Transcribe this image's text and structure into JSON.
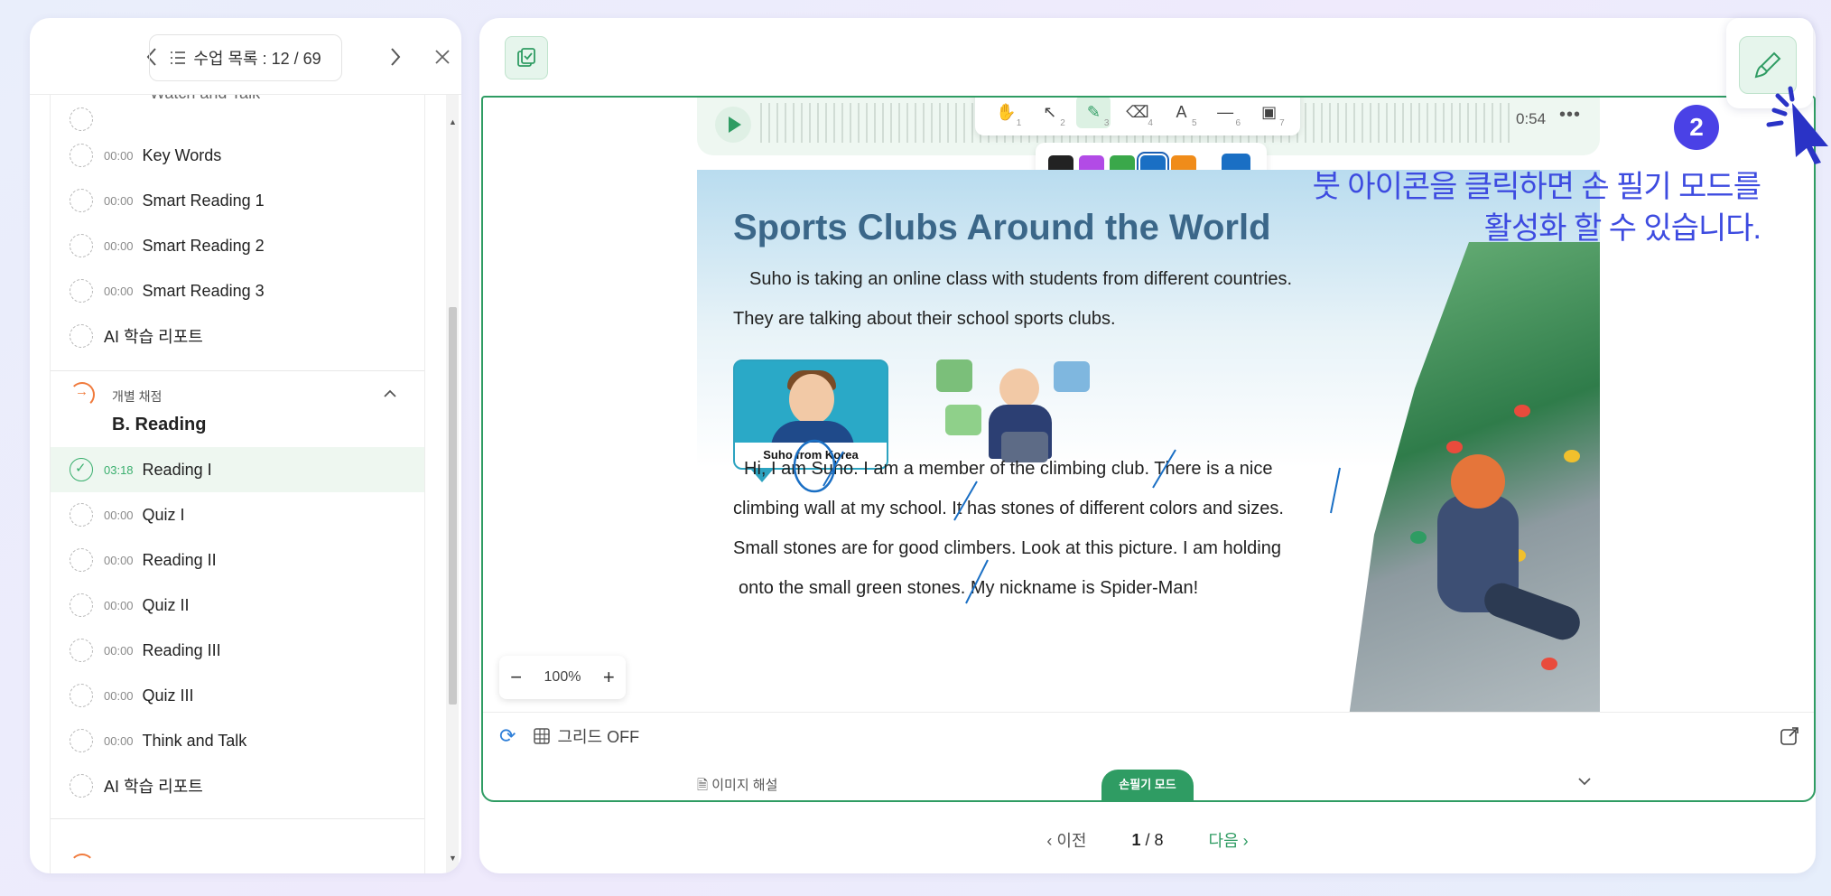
{
  "nav": {
    "list_label": "수업 목록 : 12 / 69",
    "prev_icon": "chevron-left-icon",
    "next_icon": "chevron-right-icon",
    "close_icon": "close-icon"
  },
  "sidebar": {
    "partial_top_label": "Watch and Talk",
    "items_a": [
      {
        "time": "00:00",
        "label": "Key Words"
      },
      {
        "time": "00:00",
        "label": "Smart Reading 1"
      },
      {
        "time": "00:00",
        "label": "Smart Reading 2"
      },
      {
        "time": "00:00",
        "label": "Smart Reading 3"
      },
      {
        "time": "",
        "label": "AI 학습 리포트"
      }
    ],
    "section": {
      "tag": "개별 채점",
      "title": "B. Reading"
    },
    "items_b": [
      {
        "time": "03:18",
        "label": "Reading I",
        "active": true
      },
      {
        "time": "00:00",
        "label": "Quiz I"
      },
      {
        "time": "00:00",
        "label": "Reading II"
      },
      {
        "time": "00:00",
        "label": "Quiz II"
      },
      {
        "time": "00:00",
        "label": "Reading III"
      },
      {
        "time": "00:00",
        "label": "Quiz III"
      },
      {
        "time": "00:00",
        "label": "Think and Talk"
      },
      {
        "time": "",
        "label": "AI 학습 리포트"
      }
    ]
  },
  "audio": {
    "time": "0:54",
    "more": "•••"
  },
  "tools": [
    {
      "icon": "hand-icon",
      "glyph": "✋",
      "num": "1"
    },
    {
      "icon": "pointer-icon",
      "glyph": "↖",
      "num": "2"
    },
    {
      "icon": "pen-icon",
      "glyph": "✎",
      "num": "3",
      "active": true
    },
    {
      "icon": "eraser-icon",
      "glyph": "⌫",
      "num": "4"
    },
    {
      "icon": "text-icon",
      "glyph": "A",
      "num": "5"
    },
    {
      "icon": "line-icon",
      "glyph": "—",
      "num": "6"
    },
    {
      "icon": "image-icon",
      "glyph": "▣",
      "num": "7"
    }
  ],
  "colors": [
    "#222222",
    "#b24be6",
    "#3aa84a",
    "#1a6fc4",
    "#f08c1a",
    "#1a6fc4"
  ],
  "book": {
    "title": "Sports Clubs Around the World",
    "intro1": "Suho is taking an online class with students from different countries.",
    "intro2": "They are talking about their school sports clubs.",
    "card_label": "Suho from Korea",
    "p1": "Hi, I am Suho. I am a member of the climbing club. There is a nice",
    "p2": "climbing wall at my school. It has stones of different colors and sizes.",
    "p3": "Small stones are for good climbers. Look at this picture. I am holding",
    "p4": "onto the small green stones. My nickname is Spider-Man!"
  },
  "zoom": {
    "value": "100%",
    "minus": "−",
    "plus": "+"
  },
  "bottom": {
    "grid_label": "그리드 OFF",
    "img_desc": "이미지 해설",
    "mode_tab": "손필기 모드"
  },
  "pager": {
    "prev": "이전",
    "current": "1",
    "total": "/ 8",
    "next": "다음"
  },
  "annotation": {
    "step": "2",
    "line1": "붓 아이콘을 클릭하면 손 필기 모드를",
    "line2": "활성화 할 수 있습니다."
  }
}
